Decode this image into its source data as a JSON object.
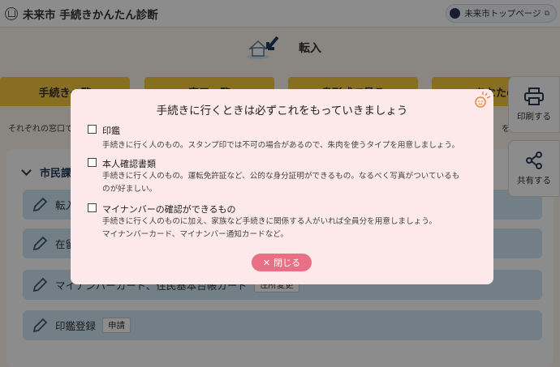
{
  "header": {
    "site_title": "未来市 手続きかんたん診断",
    "top_link": "未来市トップページ"
  },
  "hero": {
    "title": "転入"
  },
  "tabs": [
    {
      "label": "手続き一覧"
    },
    {
      "label": "窓口一覧"
    },
    {
      "label": "書形式で見る"
    },
    {
      "label": "あなたの"
    }
  ],
  "description": {
    "left": "それぞれの窓口で",
    "right": "を"
  },
  "section": {
    "title": "市民課"
  },
  "rows": [
    {
      "label": "転入",
      "tag": ""
    },
    {
      "label": "在留",
      "tag": ""
    },
    {
      "label": "マイナンバーカード、住民基本台帳カード",
      "tag": "住所変更"
    },
    {
      "label": "印鑑登録",
      "tag": "申請"
    }
  ],
  "side_buttons": {
    "print": "印刷する",
    "share": "共有する"
  },
  "modal": {
    "title": "手続きに行くときは必ずこれをもっていきましょう",
    "items": [
      {
        "title": "印鑑",
        "desc_lines": [
          "手続きに行く人のもの。スタンプ印では不可の場合があるので、朱肉を使うタイプを用意しましょう。"
        ]
      },
      {
        "title": "本人確認書類",
        "desc_lines": [
          "手続きに行く人のもの。運転免許証など、公的な身分証明ができるもの。なるべく写真がついているも",
          "のが好ましい。"
        ]
      },
      {
        "title": "マイナンバーの確認ができるもの",
        "desc_lines": [
          "手続きに行く人のものに加え、家族など手続きに関係する人がいれば全員分を用意しましょう。",
          "マイナンバーカード、マイナンバー通知カードなど。"
        ]
      }
    ],
    "close_label": "閉じる"
  },
  "colors": {
    "accent_yellow": "#f6c83d",
    "modal_bg": "#fde9ea",
    "close_button": "#e86f84",
    "row_bg": "#cfe8f5"
  }
}
